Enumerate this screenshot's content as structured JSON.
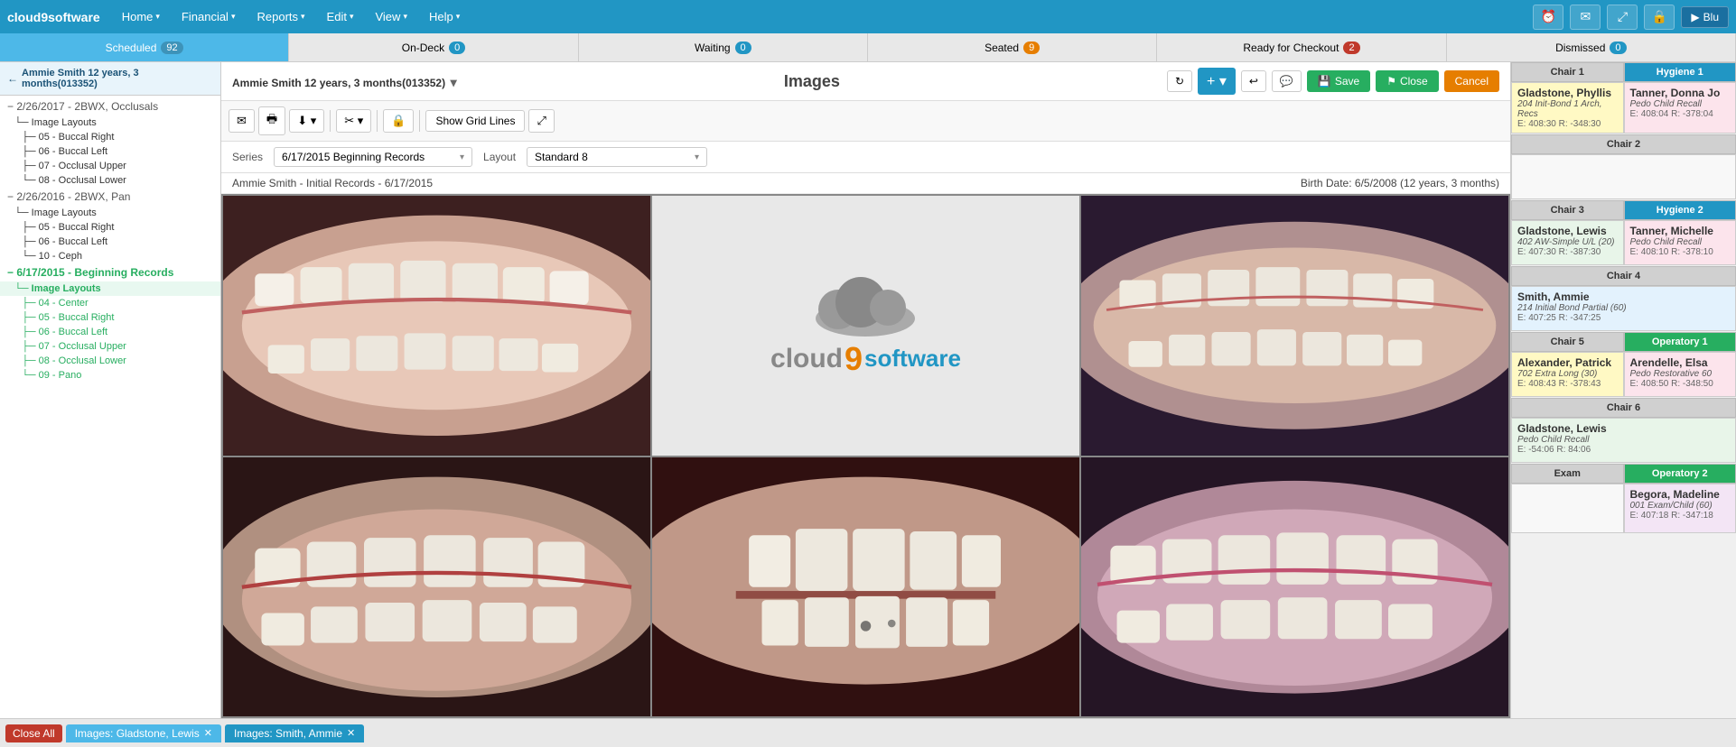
{
  "topnav": {
    "logo": "cloud9software",
    "items": [
      {
        "label": "Home",
        "has_dropdown": true
      },
      {
        "label": "Financial",
        "has_dropdown": true
      },
      {
        "label": "Reports",
        "has_dropdown": true
      },
      {
        "label": "Edit",
        "has_dropdown": true
      },
      {
        "label": "View",
        "has_dropdown": true
      },
      {
        "label": "Help",
        "has_dropdown": true
      }
    ],
    "icons": [
      "clock-icon",
      "email-icon",
      "expand-icon",
      "lock-icon"
    ],
    "blu_label": "Blu"
  },
  "tabs": [
    {
      "id": "scheduled",
      "label": "Scheduled",
      "badge": "92",
      "active": false
    },
    {
      "id": "on-deck",
      "label": "On-Deck",
      "badge": "0",
      "active": false
    },
    {
      "id": "waiting",
      "label": "Waiting",
      "badge": "0",
      "active": false
    },
    {
      "id": "seated",
      "label": "Seated",
      "badge": "9",
      "active": false
    },
    {
      "id": "ready",
      "label": "Ready for Checkout",
      "badge": "2",
      "active": false
    },
    {
      "id": "dismissed",
      "label": "Dismissed",
      "badge": "0",
      "active": false
    }
  ],
  "sidebar": {
    "header": "← Ammie Smith 12 years, 3 months(013352)",
    "tree": [
      {
        "type": "group",
        "label": "2/26/2017 - 2BWX, Occlusals"
      },
      {
        "type": "item",
        "label": "Image Layouts",
        "indent": 1
      },
      {
        "type": "item",
        "label": "05 - Buccal Right",
        "indent": 2
      },
      {
        "type": "item",
        "label": "06 - Buccal Left",
        "indent": 2
      },
      {
        "type": "item",
        "label": "07 - Occlusal Upper",
        "indent": 2
      },
      {
        "type": "item",
        "label": "08 - Occlusal Lower",
        "indent": 2
      },
      {
        "type": "group",
        "label": "2/26/2016 - 2BWX, Pan"
      },
      {
        "type": "item",
        "label": "Image Layouts",
        "indent": 1
      },
      {
        "type": "item",
        "label": "05 - Buccal Right",
        "indent": 2
      },
      {
        "type": "item",
        "label": "06 - Buccal Left",
        "indent": 2
      },
      {
        "type": "item",
        "label": "10 - Ceph",
        "indent": 2
      },
      {
        "type": "group",
        "label": "6/17/2015 - Beginning Records",
        "green": true
      },
      {
        "type": "item",
        "label": "Image Layouts",
        "indent": 1,
        "green_bold": true,
        "active": true
      },
      {
        "type": "item",
        "label": "04 - Center",
        "indent": 2,
        "green": true
      },
      {
        "type": "item",
        "label": "05 - Buccal Right",
        "indent": 2,
        "green": true
      },
      {
        "type": "item",
        "label": "06 - Buccal Left",
        "indent": 2,
        "green": true
      },
      {
        "type": "item",
        "label": "07 - Occlusal Upper",
        "indent": 2,
        "green": true
      },
      {
        "type": "item",
        "label": "08 - Occlusal Lower",
        "indent": 2,
        "green": true
      },
      {
        "type": "item",
        "label": "09 - Pano",
        "indent": 2,
        "green": true
      }
    ]
  },
  "patient": {
    "name": "Ammie Smith 12 years, 3 months(013352)",
    "name_caret": "▾",
    "images_title": "Images",
    "info_line": "Ammie Smith - Initial Records - 6/17/2015",
    "birth_date": "Birth Date: 6/5/2008 (12 years, 3 months)"
  },
  "image_toolbar": {
    "show_grid_label": "Show Grid Lines",
    "buttons": [
      "email-icon",
      "print-icon",
      "download-icon",
      "crop-icon",
      "lock-icon",
      "expand-icon"
    ]
  },
  "series": {
    "label": "Series",
    "value": "6/17/2015 Beginning Records",
    "layout_label": "Layout",
    "layout_value": "Standard 8"
  },
  "action_buttons": {
    "save": "Save",
    "close": "Close",
    "cancel": "Cancel"
  },
  "right_panel": {
    "columns": [
      {
        "label": "Chair 1",
        "type": "normal"
      },
      {
        "label": "Hygiene 1",
        "type": "hygiene"
      }
    ],
    "chairs": [
      {
        "id": "chair1",
        "label": "Chair 1",
        "type": "normal",
        "patients": [
          {
            "name": "Gladstone, Phyllis",
            "info": "204 Init-Bond 1 Arch, Recs",
            "codes": "E: 408:30 R: -348:30",
            "color": "yellow"
          }
        ]
      },
      {
        "id": "hygiene1",
        "label": "Hygiene 1",
        "type": "hygiene",
        "patients": [
          {
            "name": "Tanner, Donna Jo",
            "info": "Pedo Child Recall",
            "codes": "E: 408:04 R: -378:04",
            "color": "pink"
          }
        ]
      },
      {
        "id": "chair2",
        "label": "Chair 2",
        "type": "normal",
        "patients": []
      },
      {
        "id": "chair3",
        "label": "Chair 3",
        "type": "normal",
        "patients": [
          {
            "name": "Gladstone, Lewis",
            "info": "402 AW-Simple U/L (20)",
            "codes": "E: 407:30 R: -387:30",
            "color": "green"
          }
        ]
      },
      {
        "id": "hygiene2",
        "label": "Hygiene 2",
        "type": "hygiene",
        "patients": [
          {
            "name": "Tanner, Michelle",
            "info": "Pedo Child Recall",
            "codes": "E: 408:10 R: -378:10",
            "color": "pink"
          }
        ]
      },
      {
        "id": "chair4",
        "label": "Chair 4",
        "type": "normal",
        "patients": [
          {
            "name": "Smith, Ammie",
            "info": "214 Initial Bond Partial (60)",
            "codes": "E: 407:25 R: -347:25",
            "color": "blue"
          }
        ]
      },
      {
        "id": "chair5",
        "label": "Chair 5",
        "type": "normal",
        "patients": [
          {
            "name": "Alexander, Patrick",
            "info": "702 Extra Long (30)",
            "codes": "E: 408:43 R: -378:43",
            "color": "yellow"
          }
        ]
      },
      {
        "id": "operatory1",
        "label": "Operatory 1",
        "type": "operatory",
        "patients": [
          {
            "name": "Arendelle, Elsa",
            "info": "Pedo Restorative 60",
            "codes": "E: 408:50 R: -348:50",
            "color": "pink"
          }
        ]
      },
      {
        "id": "chair6",
        "label": "Chair 6",
        "type": "normal",
        "patients": [
          {
            "name": "Gladstone, Lewis",
            "info": "Pedo Child Recall",
            "codes": "E: -54:06 R: 84:06",
            "color": "green"
          }
        ]
      },
      {
        "id": "exam",
        "label": "Exam",
        "type": "normal",
        "patients": []
      },
      {
        "id": "operatory2",
        "label": "Operatory 2",
        "type": "operatory",
        "patients": [
          {
            "name": "Begora, Madeline",
            "info": "001 Exam/Child (60)",
            "codes": "E: 407:18 R: -347:18",
            "color": "purple"
          }
        ]
      }
    ]
  },
  "bottom_tabs": {
    "close_all": "Close All",
    "tabs": [
      {
        "label": "Images: Gladstone, Lewis",
        "closable": true
      },
      {
        "label": "Images: Smith, Ammie",
        "closable": true
      }
    ]
  }
}
